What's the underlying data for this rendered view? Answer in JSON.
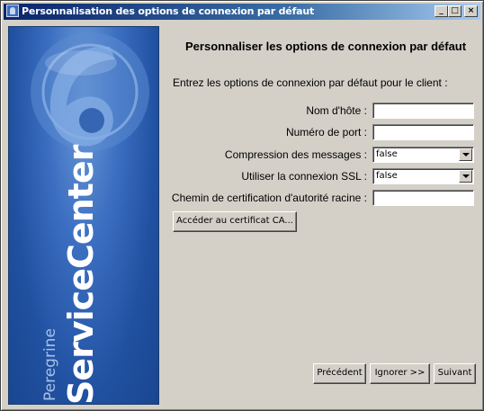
{
  "window": {
    "title": "Personnalisation des options de connexion par défaut",
    "controls": [
      "_",
      "□",
      "×"
    ]
  },
  "sidebar": {
    "brand_small": "Peregrine",
    "brand_big": "ServiceCenter",
    "logo_mark": "6"
  },
  "main": {
    "heading": "Personnaliser les options de connexion par défaut",
    "intro": "Entrez les options de connexion par défaut pour le client :",
    "fields": {
      "host_label": "Nom d'hôte :",
      "host_value": "",
      "port_label": "Numéro de port :",
      "port_value": "",
      "compression_label": "Compression des messages :",
      "compression_value": "false",
      "ssl_label": "Utiliser la connexion SSL :",
      "ssl_value": "false",
      "ca_path_label": "Chemin de certification d'autorité racine :",
      "ca_path_value": ""
    },
    "browse_ca_button": "Accéder au certificat CA..."
  },
  "footer": {
    "previous_button": "Précédent",
    "skip_button": "Ignorer >>",
    "next_button": "Suivant"
  }
}
